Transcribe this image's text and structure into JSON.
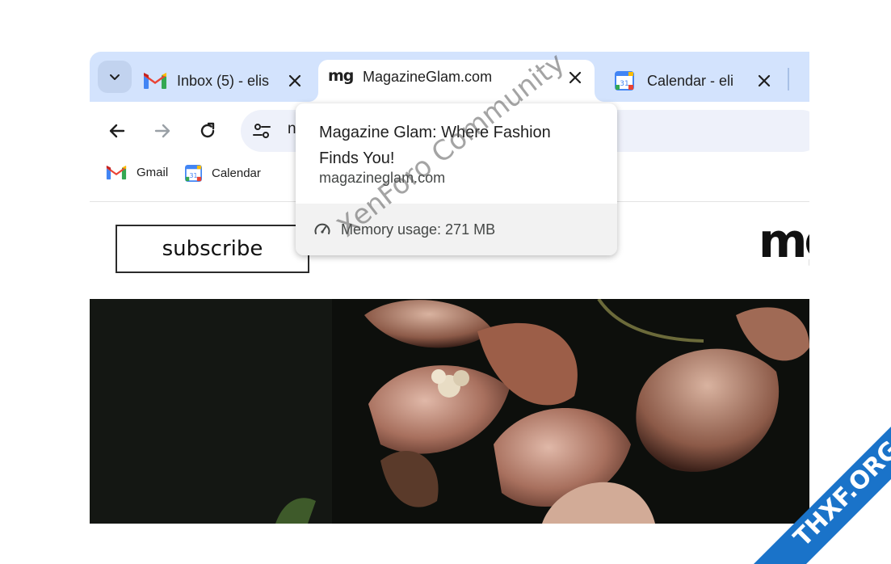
{
  "tabs": [
    {
      "title": "Inbox (5) - elis",
      "icon": "gmail-icon",
      "active": false
    },
    {
      "title": "MagazineGlam.com",
      "icon": "magazineglam-favicon",
      "active": true
    },
    {
      "title": "Calendar - eli",
      "icon": "calendar-icon",
      "active": false
    }
  ],
  "favicon_text": "mg",
  "toolbar": {
    "url_visible": "n"
  },
  "bookmarks": [
    {
      "label": "Gmail",
      "icon": "gmail-icon"
    },
    {
      "label": "Calendar",
      "icon": "calendar-icon"
    }
  ],
  "calendar_icon_day": "31",
  "page": {
    "subscribe_label": "subscribe",
    "logo_text": "mg"
  },
  "hover_card": {
    "title": "Magazine Glam: Where Fashion Finds You!",
    "domain": "magazineglam.com",
    "memory": "Memory usage: 271 MB"
  },
  "watermark": "XenForo Community",
  "corner_badge": "THXF.ORG",
  "colors": {
    "tabstrip": "#d3e3fd",
    "omnibox": "#eef1fa",
    "badge": "#1a73c9"
  }
}
